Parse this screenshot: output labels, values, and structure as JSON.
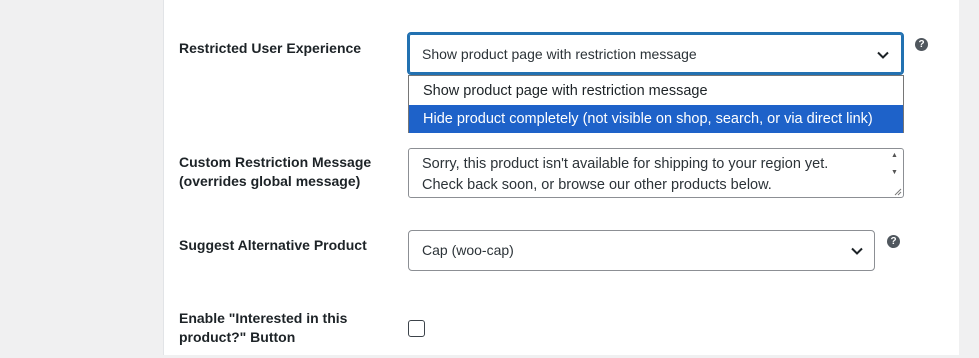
{
  "restricted_ux": {
    "label": "Restricted User Experience",
    "selected": "Show product page with restriction message",
    "options": [
      "Show product page with restriction message",
      "Hide product completely (not visible on shop, search, or via direct link)"
    ],
    "help": "?"
  },
  "custom_message": {
    "label_line1": "Custom Restriction Message",
    "label_line2": "(overrides global message)",
    "value_line1": "Sorry, this product isn't available for shipping to your region yet.",
    "value_line2": "Check back soon, or browse our other products below."
  },
  "alt_product": {
    "label": "Suggest Alternative Product",
    "selected": "Cap (woo-cap)",
    "help": "?"
  },
  "interested_button": {
    "label_line1": "Enable \"Interested in this",
    "label_line2": "product?\" Button",
    "checked": false
  },
  "colors": {
    "focus_border": "#2271b1",
    "option_highlight": "#1e62c9",
    "page_bg": "#f0f0f1"
  }
}
